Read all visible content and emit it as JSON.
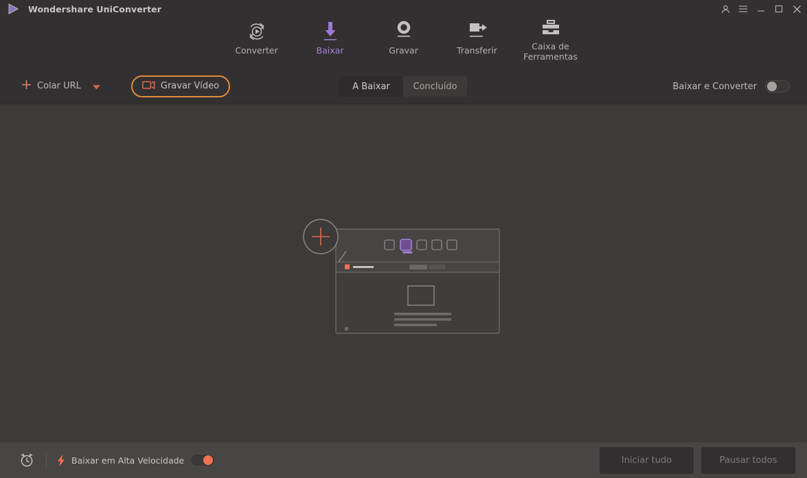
{
  "window": {
    "app_title": "Wondershare UniConverter",
    "logo_icon": "play-triangle-icon",
    "controls": [
      {
        "name": "account-icon",
        "glyph": "person-icon"
      },
      {
        "name": "menu-icon",
        "glyph": "hamburger-icon"
      },
      {
        "name": "minimize-icon",
        "glyph": "minimize-icon"
      },
      {
        "name": "maximize-icon",
        "glyph": "maximize-icon"
      },
      {
        "name": "close-icon",
        "glyph": "close-icon"
      }
    ]
  },
  "nav": {
    "active_index": 1,
    "items": [
      {
        "label": "Converter",
        "icon": "convert-circle-icon"
      },
      {
        "label": "Baixar",
        "icon": "download-arrow-icon"
      },
      {
        "label": "Gravar",
        "icon": "record-circle-icon"
      },
      {
        "label": "Transferir",
        "icon": "transfer-arrow-icon"
      },
      {
        "label": "Caixa de\nFerramentas",
        "label_line1": "Caixa de",
        "label_line2": "Ferramentas",
        "icon": "toolbox-icon"
      }
    ]
  },
  "toolbar": {
    "paste_url_label": "Colar URL",
    "paste_url_icon": "plus-icon",
    "paste_url_caret": "chevron-down-icon",
    "record_video_label": "Gravar Vídeo",
    "record_video_icon": "video-camera-icon",
    "tabs": [
      {
        "label": "A Baixar",
        "active": true
      },
      {
        "label": "Concluído",
        "active": false
      }
    ],
    "download_convert_label": "Baixar e Converter",
    "download_convert_toggle": "off"
  },
  "main": {
    "illustration": "browser-window-placeholder-illustration",
    "magnifier_icon": "plus-magnifier-icon"
  },
  "bottom": {
    "schedule_icon": "alarm-clock-icon",
    "high_speed_icon": "lightning-bolt-icon",
    "high_speed_label": "Baixar em Alta Velocidade",
    "high_speed_toggle": "on",
    "start_all_label": "Iniciar tudo",
    "pause_all_label": "Pausar todos"
  },
  "colors": {
    "accent_purple": "#9b7fc9",
    "accent_orange": "#e08c3e",
    "accent_salmon": "#ef7352",
    "header_bg": "#333031",
    "main_bg": "#3d3a3a",
    "bottom_bg": "#484545"
  }
}
